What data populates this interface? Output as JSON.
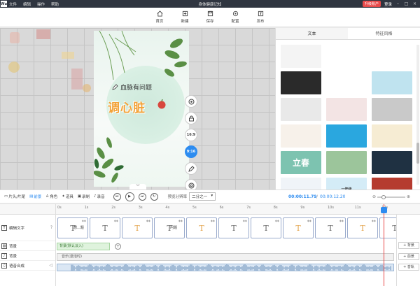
{
  "app": {
    "logo": "Wu",
    "title": "身体健康记知",
    "menu": [
      "文件",
      "编辑",
      "操作",
      "帮助"
    ],
    "upgrade": "升级账户",
    "login": "登录"
  },
  "toolbar": [
    {
      "label": "首页",
      "icon": "home-icon"
    },
    {
      "label": "新建",
      "icon": "new-icon"
    },
    {
      "label": "保存",
      "icon": "save-icon"
    },
    {
      "label": "配置",
      "icon": "settings-icon"
    },
    {
      "label": "发布",
      "icon": "publish-icon"
    }
  ],
  "canvas": {
    "subtitle": "血脉有问题",
    "title": "调心脏",
    "side_buttons": [
      "",
      "",
      "16:9",
      "9:16",
      "",
      ""
    ]
  },
  "right_panel": {
    "tabs": [
      "文本",
      "特征风格"
    ],
    "templates": [
      {
        "label": "",
        "bg": "#f4f4f4"
      },
      {
        "label": "",
        "bg": "#ffffff"
      },
      {
        "label": "",
        "bg": "#ffffff"
      },
      {
        "label": "",
        "bg": "#2a2a2a"
      },
      {
        "label": "",
        "bg": "#ffffff"
      },
      {
        "label": "",
        "bg": "#bfe3ef"
      },
      {
        "label": "",
        "bg": "#e9e9e9"
      },
      {
        "label": "",
        "bg": "#f3e4e4"
      },
      {
        "label": "",
        "bg": "#c9c9c9"
      },
      {
        "label": "",
        "bg": "#f7f1ea"
      },
      {
        "label": "",
        "bg": "#2aa7df"
      },
      {
        "label": "",
        "bg": "#f6ecd3"
      },
      {
        "label": "立春",
        "bg": "#7dc3b0"
      },
      {
        "label": "",
        "bg": "#9cc59b"
      },
      {
        "label": "",
        "bg": "#1f3142"
      },
      {
        "label": "",
        "bg": "#f0f4f8"
      },
      {
        "label": "一年级",
        "bg": "#d4ecf7"
      },
      {
        "label": "",
        "bg": "#b53b2f"
      }
    ]
  },
  "timeline": {
    "tabs": [
      "片头/片尾",
      "前景",
      "角色",
      "道具",
      "录制",
      "录音"
    ],
    "resolution_label": "预览分辨率",
    "resolution_value": "二分之一",
    "current_time": "00:00:11.79",
    "total_time": "00:00:12.20",
    "ruler": [
      "0s",
      "1s",
      "2s",
      "3s",
      "4s",
      "5s",
      "6s",
      "7s",
      "8s",
      "9s",
      "10s",
      "11s",
      "12s"
    ],
    "tracks": {
      "text": "编辑文字",
      "background": "背景",
      "music": "背景",
      "voice": "语音合成"
    },
    "text_clips": [
      {
        "txt": "想...题",
        "orange": false
      },
      {
        "txt": "",
        "orange": false
      },
      {
        "txt": "",
        "orange": true
      },
      {
        "txt": "问题",
        "orange": false
      },
      {
        "txt": "",
        "orange": true
      },
      {
        "txt": "",
        "orange": false
      },
      {
        "txt": "",
        "orange": false
      },
      {
        "txt": "",
        "orange": true
      },
      {
        "txt": "",
        "orange": false
      },
      {
        "txt": "",
        "orange": true
      },
      {
        "txt": "",
        "orange": false
      }
    ],
    "bg_clip": "背景(默认淡入)",
    "music_clip": "音乐(激活时)",
    "add_buttons": [
      "+ 背景",
      "+ 前景",
      "+ 音轨"
    ]
  }
}
